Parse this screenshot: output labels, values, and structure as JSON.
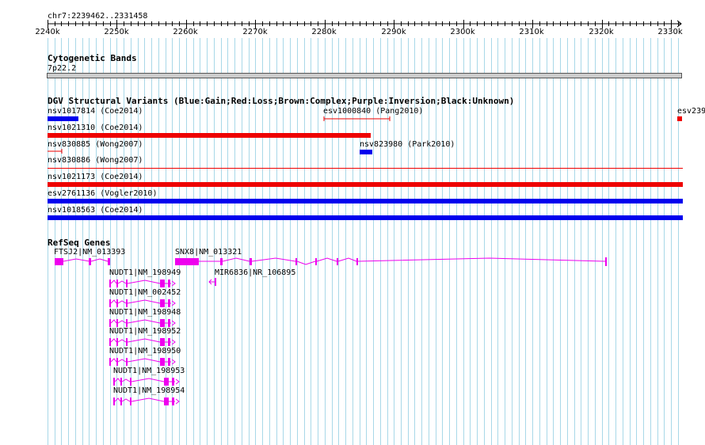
{
  "ruler": {
    "position": "chr7:2239462..2331458",
    "ticks": [
      "2240k",
      "2250k",
      "2260k",
      "2270k",
      "2280k",
      "2290k",
      "2300k",
      "2310k",
      "2320k",
      "2330k"
    ]
  },
  "tracks": {
    "cytoband": {
      "title": "Cytogenetic Bands",
      "band": "7p22.2"
    },
    "dgv": {
      "title": "DGV Structural Variants (Blue:Gain;Red:Loss;Brown:Complex;Purple:Inversion;Black:Unknown)",
      "items": [
        {
          "label": "nsv1017814 (Coe2014)",
          "type": "gain"
        },
        {
          "label": "esv1000840 (Pang2010)",
          "type": "loss"
        },
        {
          "label": "esv239",
          "type": "loss"
        },
        {
          "label": "nsv1021310 (Coe2014)",
          "type": "loss"
        },
        {
          "label": "nsv830885 (Wong2007)",
          "type": "loss"
        },
        {
          "label": "nsv823980 (Park2010)",
          "type": "gain"
        },
        {
          "label": "nsv830886 (Wong2007)",
          "type": "loss"
        },
        {
          "label": "nsv1021173 (Coe2014)",
          "type": "loss"
        },
        {
          "label": "esv2761136 (Vogler2010)",
          "type": "gain"
        },
        {
          "label": "nsv1018563 (Coe2014)",
          "type": "gain"
        }
      ]
    },
    "refseq": {
      "title": "RefSeq Genes",
      "genes": [
        {
          "label": "FTSJ2|NM_013393",
          "strand": "-"
        },
        {
          "label": "SNX8|NM_013321",
          "strand": "-"
        },
        {
          "label": "MIR6836|NR_106895",
          "strand": "-"
        },
        {
          "label": "NUDT1|NM_198949",
          "strand": "+"
        },
        {
          "label": "NUDT1|NM_002452",
          "strand": "+"
        },
        {
          "label": "NUDT1|NM_198948",
          "strand": "+"
        },
        {
          "label": "NUDT1|NM_198952",
          "strand": "+"
        },
        {
          "label": "NUDT1|NM_198950",
          "strand": "+"
        },
        {
          "label": "NUDT1|NM_198953",
          "strand": "+"
        },
        {
          "label": "NUDT1|NM_198954",
          "strand": "+"
        }
      ]
    }
  },
  "colors": {
    "gain": "#0000ee",
    "loss": "#ee0000",
    "gene": "#ee00ee",
    "grid": "#a8d8e8",
    "band": "#cccccc"
  }
}
